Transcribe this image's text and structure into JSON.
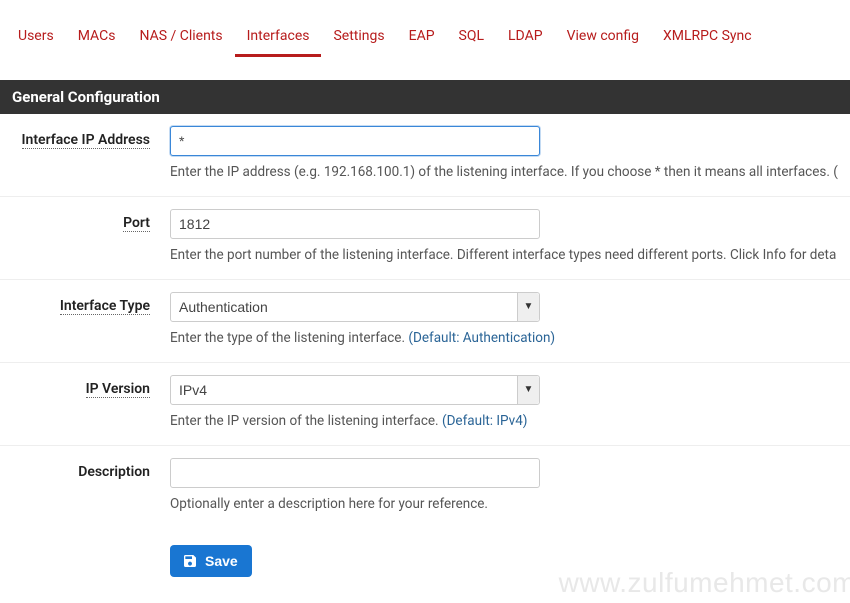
{
  "tabs": [
    {
      "label": "Users",
      "active": false
    },
    {
      "label": "MACs",
      "active": false
    },
    {
      "label": "NAS / Clients",
      "active": false
    },
    {
      "label": "Interfaces",
      "active": true
    },
    {
      "label": "Settings",
      "active": false
    },
    {
      "label": "EAP",
      "active": false
    },
    {
      "label": "SQL",
      "active": false
    },
    {
      "label": "LDAP",
      "active": false
    },
    {
      "label": "View config",
      "active": false
    },
    {
      "label": "XMLRPC Sync",
      "active": false
    }
  ],
  "section_title": "General Configuration",
  "fields": {
    "ip": {
      "label": "Interface IP Address",
      "value": "*",
      "help": "Enter the IP address (e.g. 192.168.100.1) of the listening interface. If you choose * then it means all interfaces. ("
    },
    "port": {
      "label": "Port",
      "value": "1812",
      "help": "Enter the port number of the listening interface. Different interface types need different ports. Click Info for deta"
    },
    "iftype": {
      "label": "Interface Type",
      "value": "Authentication",
      "help_prefix": "Enter the type of the listening interface. ",
      "help_link": "(Default: Authentication)"
    },
    "ipver": {
      "label": "IP Version",
      "value": "IPv4",
      "help_prefix": "Enter the IP version of the listening interface. ",
      "help_link": "(Default: IPv4)"
    },
    "desc": {
      "label": "Description",
      "value": "",
      "help": "Optionally enter a description here for your reference."
    }
  },
  "save_label": "Save",
  "watermark": "www.zulfumehmet.com"
}
